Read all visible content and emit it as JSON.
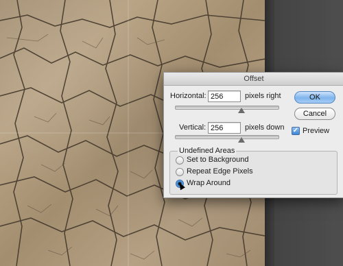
{
  "dialog": {
    "title": "Offset",
    "horizontal": {
      "label": "Horizontal:",
      "value": "256",
      "unit": "pixels right"
    },
    "vertical": {
      "label": "Vertical:",
      "value": "256",
      "unit": "pixels down"
    },
    "buttons": {
      "ok": "OK",
      "cancel": "Cancel"
    },
    "preview": {
      "label": "Preview",
      "checked": true
    },
    "undefined_areas": {
      "legend": "Undefined Areas",
      "options": [
        {
          "label": "Set to Background",
          "selected": false
        },
        {
          "label": "Repeat Edge Pixels",
          "selected": false
        },
        {
          "label": "Wrap Around",
          "selected": true
        }
      ]
    }
  },
  "icons": {
    "checkmark": "checkmark-icon",
    "cursor": "pointer-cursor-icon"
  }
}
